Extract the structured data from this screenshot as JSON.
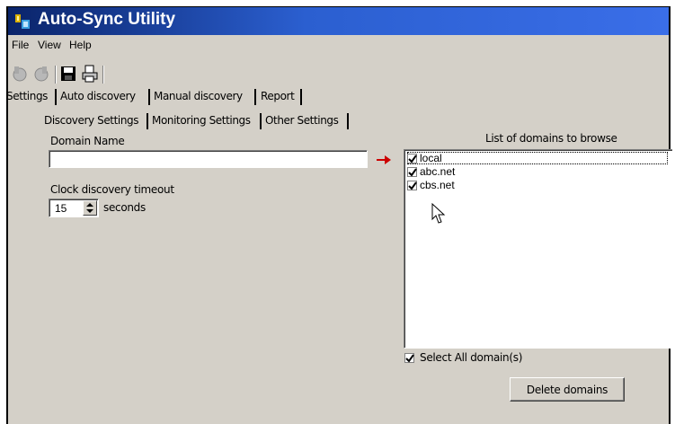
{
  "window": {
    "title": "Auto-Sync Utility",
    "title_bar_color": "#0a246a"
  },
  "menu": {
    "items": [
      "File",
      "View",
      "Help"
    ]
  },
  "toolbar": {
    "icons": [
      "back-icon",
      "forward-icon",
      "save-icon",
      "print-icon"
    ]
  },
  "tabs_main": [
    "Settings",
    "Auto discovery",
    "Manual discovery",
    "Report"
  ],
  "tabs_sub": [
    "Discovery Settings",
    "Monitoring Settings",
    "Other Settings"
  ],
  "form": {
    "domain_label": "Domain Name",
    "domain_value": "",
    "timeout_label": "Clock discovery timeout",
    "timeout_value": "15",
    "timeout_unit": "seconds"
  },
  "domains": {
    "header": "List of domains to browse",
    "items": [
      {
        "label": "local",
        "checked": true
      },
      {
        "label": "abc.net",
        "checked": true
      },
      {
        "label": "cbs.net",
        "checked": true
      }
    ],
    "select_all_label": "Select All domain(s)",
    "select_all_checked": true
  },
  "buttons": {
    "delete_label": "Delete domains"
  },
  "colors": {
    "accent_arrow": "#cc0000",
    "window_bg": "#d4d0c8"
  }
}
